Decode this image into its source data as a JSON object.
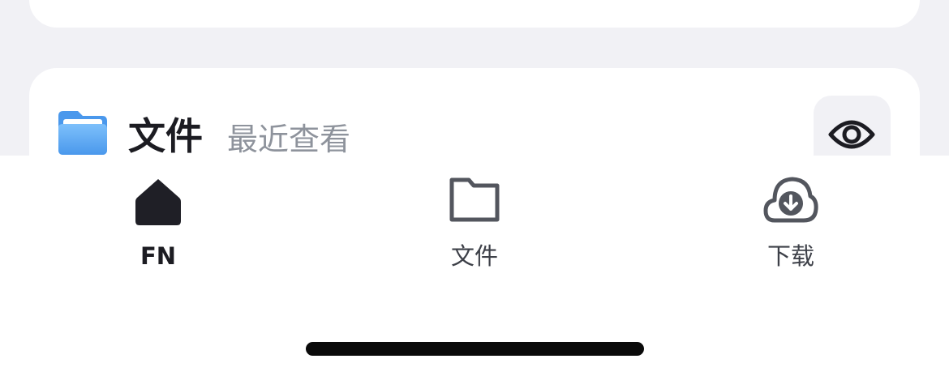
{
  "files_section": {
    "title": "文件",
    "subtitle": "最近查看",
    "folder_icon": "folder-icon",
    "view_toggle_icon": "eye-icon"
  },
  "tabbar": {
    "tabs": [
      {
        "label": "FN",
        "icon": "home-icon",
        "active": true
      },
      {
        "label": "文件",
        "icon": "folder-icon",
        "active": false
      },
      {
        "label": "下载",
        "icon": "cloud-download-icon",
        "active": false
      }
    ]
  },
  "colors": {
    "background": "#f1f1f5",
    "card": "#ffffff",
    "text_primary": "#1c1c22",
    "text_secondary": "#8e939c",
    "icon_gray": "#53565e",
    "folder_blue": "#5aa9f3"
  }
}
